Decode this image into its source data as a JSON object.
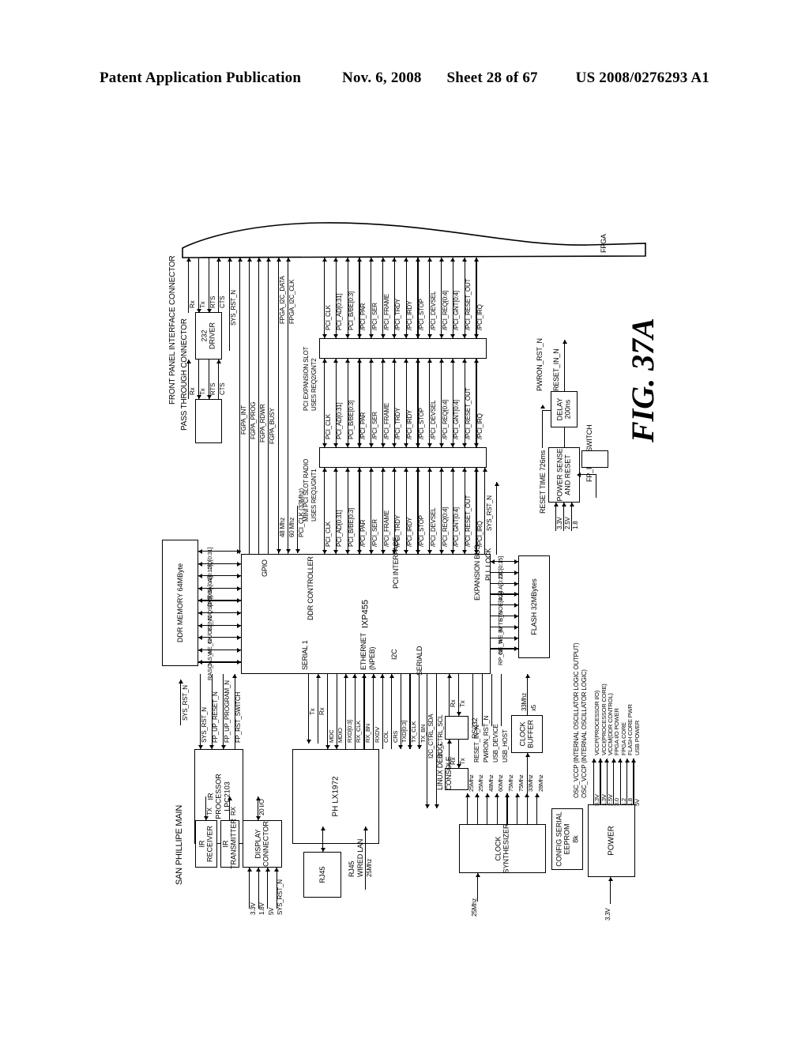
{
  "header": {
    "publication": "Patent Application Publication",
    "date": "Nov. 6, 2008",
    "sheet": "Sheet 28 of 67",
    "docnum": "US 2008/0276293 A1"
  },
  "figure": {
    "label": "FIG. 37A",
    "board_title": "SAN PHILLIPE MAIN"
  },
  "blocks": {
    "fpga": "FPGA",
    "driver232": "232\nDRIVER",
    "pass_through_connector": "PASS THROUGH CONNECTOR",
    "front_panel_interface_connector": "FRONT PANEL INTERFACE CONNECTOR",
    "mini_pci_slot": "MINI PCI SLOT RADIO\nUSES REQ1/GNT1",
    "pci_expansion_slot": "PCI EXPANSION SLOT\nUSES REQ2/GNT2",
    "ixp455": "IXP455",
    "ddr_memory": "DDR MEMORY 64MByte",
    "ddr_controller": "DDR CONTROLLER",
    "gpio": "GPIO",
    "pci_interface": "PCI INTERFACE",
    "ethernet": "ETHERNET\n(NPEB)",
    "serial1": "SERIAL 1",
    "seriald": "SERIALD",
    "i2c": "I2C",
    "expansion_bus": "EXPANSION BUS",
    "pll_lock": "PLL LOCK",
    "flash": "FLASH 32MBytes",
    "delay": "DELAY\n200ns",
    "power_sense": "POWER SENSE\nAND RESET",
    "ir_processor": "IR\nPROCESSOR\nLPC2103",
    "ir_receiver": "IR\nRECEIVER",
    "ir_transmitter": "IR\nTRANSMITTER",
    "display_connector": "DISPLAY\nCONNECTOR",
    "phlx1972": "PH LX1972",
    "rj45": "RJ45",
    "rj45_wired_lan": "RJ45\nWIRED LAN",
    "rs232": "RS232",
    "linux_debug_console": "LINUX DEBUG\nCONSOLE",
    "clock_buffer": "CLOCK\nBUFFER",
    "clock_synthesizer": "CLOCK\nSYNTHESIZER",
    "config_serial_eeprom": "CONFIG SERIAL\nEEPROM\n8k",
    "power": "POWER"
  },
  "signals": {
    "fp_serial_top": [
      "Rx",
      "Tx",
      "RTS",
      "CTS"
    ],
    "fp_serial_bottom": [
      "Rx",
      "Tx",
      "RTS",
      "CTS"
    ],
    "sys_rst_n": "SYS_RST_N",
    "fgpa": [
      "FGPA_INT",
      "FGPA_PROG",
      "FGPA_RDWR",
      "FGPA_BUSY"
    ],
    "fpga_i2c": [
      "FPGA_I2C_DATA",
      "FPGA_I2C_CLK"
    ],
    "clk_in": [
      "48 Mhz",
      "60 Mhz",
      "PCI_CLK (33Mhz)"
    ],
    "pci_bus": [
      "PCI_CLK",
      "PCI_AD[0:31]",
      "PCI_B/BE[0:3]",
      "/PCI_PAR",
      "/PCI_SER",
      "/PCI_FRAME",
      "/PCI_TRDY",
      "/PCI_IRDY",
      "/PCI_STOP",
      "/PCI_DEVSEL",
      "/PCI_REQ[0:4]",
      "/PCI_GNT[0:4]",
      "/PCI_RESET_OUT",
      "/PCI_IRQ"
    ],
    "ddr_bus": [
      "DQ[0:31]",
      "A[0:12]",
      "BA[0:2]",
      "DV[0:3]",
      "DQS[0:3]",
      "CE_N",
      "CK/CK_N",
      "WE_N",
      "CAS_N",
      "RAS_N"
    ],
    "gpio_left": [
      "SYS_RST_N",
      "FP_UP_RESET_N",
      "FP_UP_PROGRAM_N",
      "FP_RST_SWITCH"
    ],
    "serial1": [
      "Tx",
      "Rx"
    ],
    "ethernet": [
      "MDC",
      "MDIO",
      "RXD[0:3]",
      "RX_CLK",
      "RX_BN",
      "RXDV",
      "COL",
      "CRS",
      "TXD[0:3]",
      "TX_CLK",
      "TX_BN"
    ],
    "i2c_ctrl": [
      "I2C_CTRL_SDA",
      "I2C_CTRL_SCL"
    ],
    "seriald": [
      "Rx",
      "Tx"
    ],
    "console": [
      "Rx",
      "Tx"
    ],
    "expansion_bus": [
      "DC[0:15]",
      "A[0:23]",
      "A24",
      "OE[0:3]",
      "STS",
      "BYTE_N",
      "WE_N",
      "OE_N",
      "RP_N"
    ],
    "reset_block": {
      "pwron_rst_n": "PWRON_RST_N",
      "reset_in_n": "RESET_IN_N",
      "reset_time": "RESET TIME 726ms",
      "fp_rst_switch": "FP_RST_SWITCH",
      "rails": [
        "3.3V",
        "2.5V",
        "1.8"
      ]
    },
    "ir_bus": [
      "TX",
      "RX",
      "20 I/O"
    ],
    "display_rails": [
      "3.3V",
      "1.8V",
      "5V",
      "SYS_RST_N"
    ],
    "phy_clock": "25Mhz",
    "usb": [
      "RESET_IN_N",
      "PWRON_RST_N",
      "USB_DEVICE",
      "USB_HOST"
    ],
    "clock_buffer_out": [
      "33Mhz",
      "x5"
    ],
    "clock_synth_out": [
      "25Mhz",
      "25Mhz",
      "48Mhz",
      "60Mhz",
      "75Mhz",
      "75Mhz",
      "33Mhz",
      "28Mhz"
    ],
    "clock_synth_in": "25Mhz",
    "eeprom_i2c": [
      "I2C_CTRL_SDA",
      "I2C_CTRL_SCL"
    ],
    "power_in": "3.3V",
    "power_rails_v": [
      "3.3V",
      "1.3V",
      "2.5V",
      "3.0",
      "1.2",
      "1.8",
      "5V"
    ],
    "power_rails_name": [
      "VCCP(PROCESSOR I/O)",
      "VCCI(PROCESSOR CORE)",
      "VCCM(DDR CONTROL)",
      "FPGA I/O POWER",
      "FPGA CORE",
      "FLASH CORE PWR",
      "USB POWER"
    ],
    "osc_notes": [
      "OSC_VCCP (INTERNAL OSCILLATOR LOGIC OUTPUT)",
      "OSC_VCCP (INTERNAL OSCILLATOR LOGIC)"
    ]
  }
}
